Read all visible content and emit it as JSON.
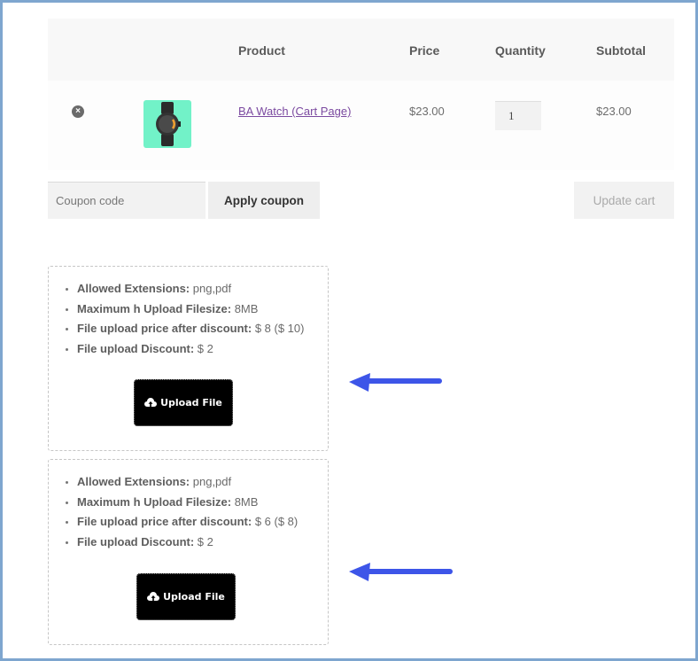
{
  "cart": {
    "columns": [
      "",
      "",
      "Product",
      "Price",
      "Quantity",
      "Subtotal"
    ],
    "items": [
      {
        "product": "BA Watch (Cart Page)",
        "price": "$23.00",
        "quantity": "1",
        "subtotal": "$23.00"
      }
    ]
  },
  "actions": {
    "coupon_placeholder": "Coupon code",
    "apply_label": "Apply coupon",
    "update_label": "Update cart"
  },
  "uploads": [
    {
      "rows": [
        {
          "label": "Allowed Extensions:",
          "value": " png,pdf"
        },
        {
          "label": "Maximum h Upload Filesize:",
          "value": " 8MB"
        },
        {
          "label": "File upload price after discount:",
          "value": " $ 8 ($ 10)"
        },
        {
          "label": "File upload Discount:",
          "value": " $ 2"
        }
      ],
      "button_label": "Upload File"
    },
    {
      "rows": [
        {
          "label": "Allowed Extensions:",
          "value": " png,pdf"
        },
        {
          "label": "Maximum h Upload Filesize:",
          "value": " 8MB"
        },
        {
          "label": "File upload price after discount:",
          "value": " $ 6 ($ 8)"
        },
        {
          "label": "File upload Discount:",
          "value": " $ 2"
        }
      ],
      "button_label": "Upload File"
    }
  ],
  "colors": {
    "arrow": "#3d55e8",
    "frame": "#7ea6cf",
    "link": "#7b4aa0"
  }
}
